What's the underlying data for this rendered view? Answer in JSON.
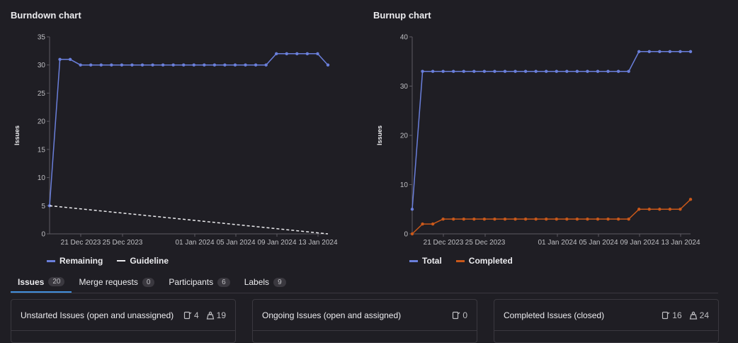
{
  "burndown": {
    "title": "Burndown chart",
    "chart_data": {
      "type": "line",
      "ylabel": "Issues",
      "ylim": [
        0,
        35
      ],
      "yticks": [
        "0",
        "5",
        "10",
        "15",
        "20",
        "25",
        "30",
        "35"
      ],
      "xticks": [
        "21 Dec 2023",
        "25 Dec 2023",
        "01 Jan 2024",
        "05 Jan 2024",
        "09 Jan 2024",
        "13 Jan 2024"
      ],
      "x_days": [
        0,
        1,
        2,
        3,
        4,
        5,
        6,
        7,
        8,
        9,
        10,
        11,
        12,
        13,
        14,
        15,
        16,
        17,
        18,
        19,
        20,
        21,
        22,
        23,
        24,
        25,
        26,
        27
      ],
      "series": [
        {
          "name": "Remaining",
          "color": "#6a7fdb",
          "values": [
            5,
            31,
            31,
            30,
            30,
            30,
            30,
            30,
            30,
            30,
            30,
            30,
            30,
            30,
            30,
            30,
            30,
            30,
            30,
            30,
            30,
            30,
            32,
            32,
            32,
            32,
            32,
            30
          ]
        },
        {
          "name": "Guideline",
          "color": "#ececef",
          "dashed": true,
          "values": [
            5,
            null,
            null,
            null,
            null,
            null,
            null,
            null,
            null,
            null,
            null,
            null,
            null,
            null,
            null,
            null,
            null,
            null,
            null,
            null,
            null,
            null,
            null,
            null,
            null,
            null,
            null,
            0
          ]
        }
      ],
      "legend": "bottom-left"
    }
  },
  "burnup": {
    "title": "Burnup chart",
    "chart_data": {
      "type": "line",
      "ylabel": "Issues",
      "ylim": [
        0,
        40
      ],
      "yticks": [
        "0",
        "10",
        "20",
        "30",
        "40"
      ],
      "xticks": [
        "21 Dec 2023",
        "25 Dec 2023",
        "01 Jan 2024",
        "05 Jan 2024",
        "09 Jan 2024",
        "13 Jan 2024"
      ],
      "x_days": [
        0,
        1,
        2,
        3,
        4,
        5,
        6,
        7,
        8,
        9,
        10,
        11,
        12,
        13,
        14,
        15,
        16,
        17,
        18,
        19,
        20,
        21,
        22,
        23,
        24,
        25,
        26,
        27
      ],
      "series": [
        {
          "name": "Total",
          "color": "#6a7fdb",
          "values": [
            5,
            33,
            33,
            33,
            33,
            33,
            33,
            33,
            33,
            33,
            33,
            33,
            33,
            33,
            33,
            33,
            33,
            33,
            33,
            33,
            33,
            33,
            37,
            37,
            37,
            37,
            37,
            37
          ]
        },
        {
          "name": "Completed",
          "color": "#c9581a",
          "values": [
            0,
            2,
            2,
            3,
            3,
            3,
            3,
            3,
            3,
            3,
            3,
            3,
            3,
            3,
            3,
            3,
            3,
            3,
            3,
            3,
            3,
            3,
            5,
            5,
            5,
            5,
            5,
            7
          ]
        }
      ],
      "legend": "bottom-left"
    }
  },
  "tabs": [
    {
      "label": "Issues",
      "count": "20",
      "active": true
    },
    {
      "label": "Merge requests",
      "count": "0"
    },
    {
      "label": "Participants",
      "count": "6"
    },
    {
      "label": "Labels",
      "count": "9"
    }
  ],
  "cards": [
    {
      "title": "Unstarted Issues (open and unassigned)",
      "issues": "4",
      "weight": "19"
    },
    {
      "title": "Ongoing Issues (open and assigned)",
      "issues": "0"
    },
    {
      "title": "Completed Issues (closed)",
      "issues": "16",
      "weight": "24"
    }
  ]
}
